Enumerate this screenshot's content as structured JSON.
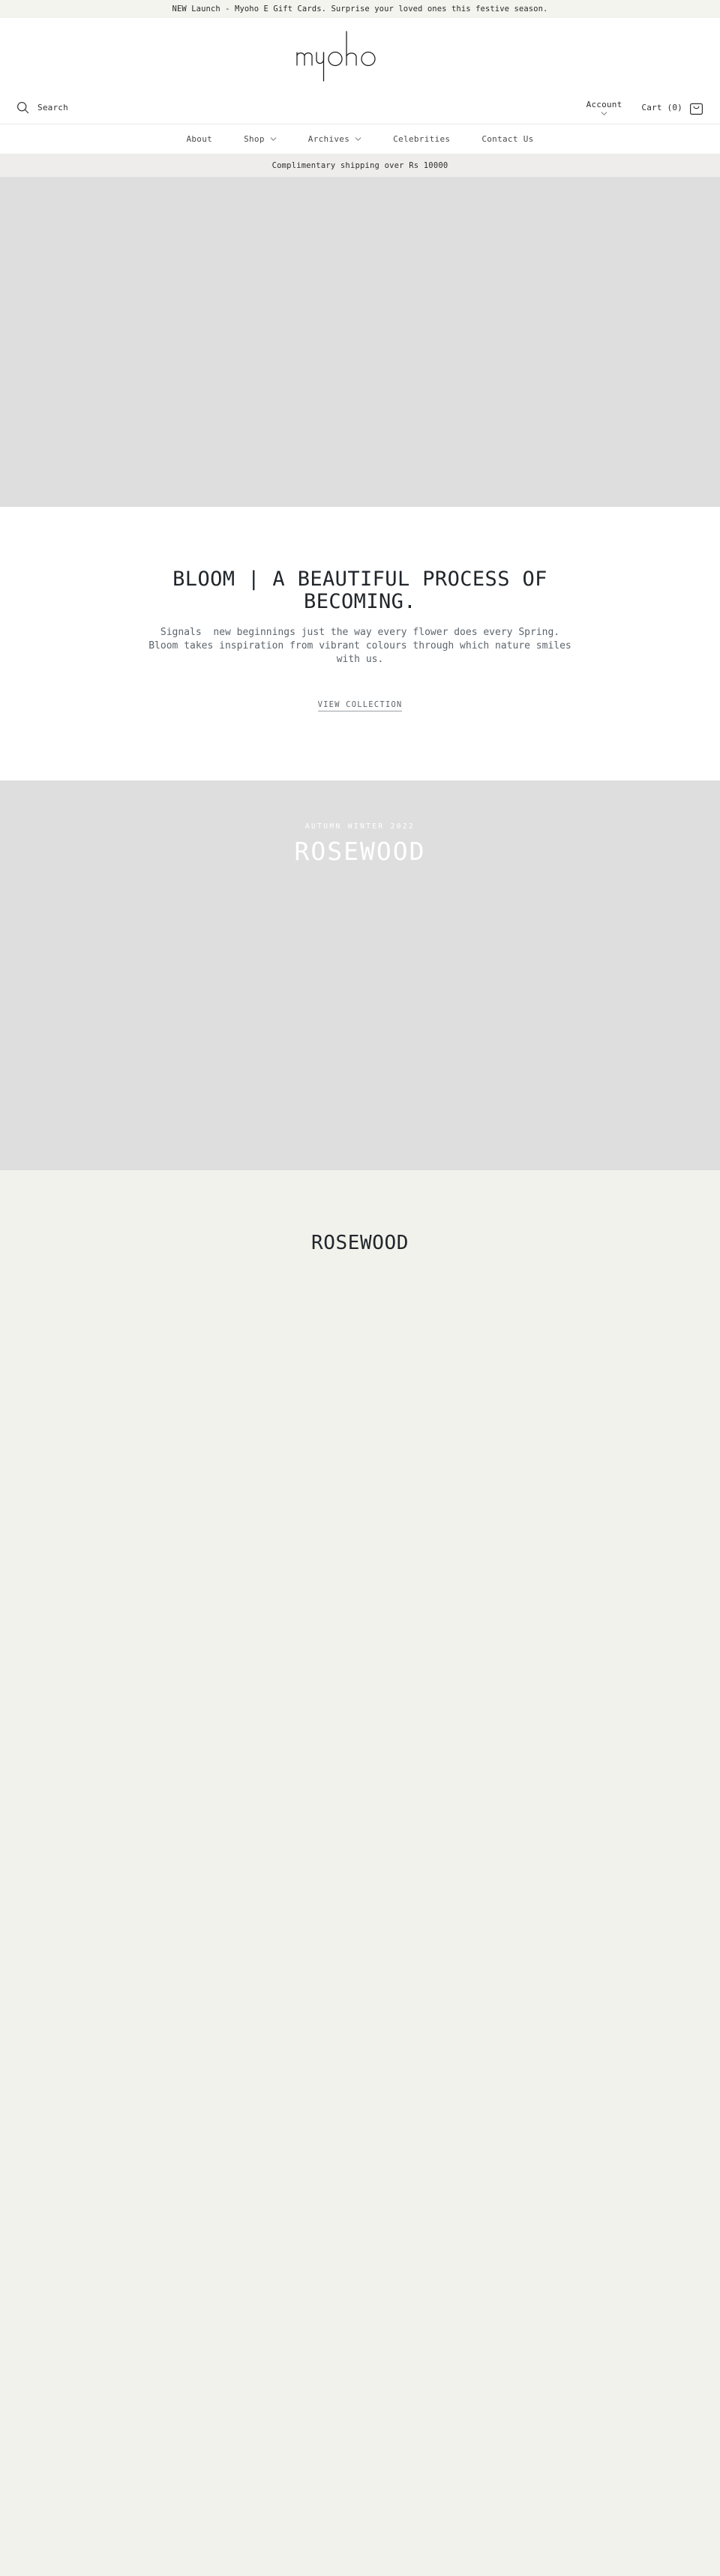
{
  "announcement": {
    "text": "NEW Launch - Myoho E Gift Cards. Surprise your loved ones this festive season."
  },
  "header": {
    "logo_text": "myoho",
    "logo_icon": "myoho-script-wordmark"
  },
  "utility": {
    "search": {
      "label": "Search",
      "icon": "search-icon"
    },
    "account": {
      "label": "Account",
      "icon": "chevron-down-icon"
    },
    "cart": {
      "label": "Cart (0)",
      "count": 0,
      "icon": "shopping-bag-icon"
    }
  },
  "nav": {
    "items": [
      {
        "label": "About",
        "has_dropdown": false
      },
      {
        "label": "Shop",
        "has_dropdown": true
      },
      {
        "label": "Archives",
        "has_dropdown": true
      },
      {
        "label": "Celebrities",
        "has_dropdown": false
      },
      {
        "label": "Contact Us",
        "has_dropdown": false
      }
    ]
  },
  "shipping": {
    "text": "Complimentary shipping over Rs 10000"
  },
  "bloom": {
    "title": "BLOOM | A BEAUTIFUL PROCESS OF BECOMING.",
    "body": "Signals  new beginnings just the way every flower does every Spring.\nBloom takes inspiration from vibrant colours through which nature smiles with us.",
    "cta_label": "VIEW COLLECTION"
  },
  "rosewood_hero": {
    "eyebrow": "AUTUMN WINTER 2022",
    "title": "ROSEWOOD"
  },
  "rosewood_lower": {
    "title": "ROSEWOOD"
  },
  "colors": {
    "announce_bg": "#f3f4ee",
    "ship_bg": "#eeedeb",
    "placeholder_gray": "#dedede",
    "cream": "#f2f2ec",
    "text_dark": "#21262b",
    "text_muted": "#5c646b"
  }
}
